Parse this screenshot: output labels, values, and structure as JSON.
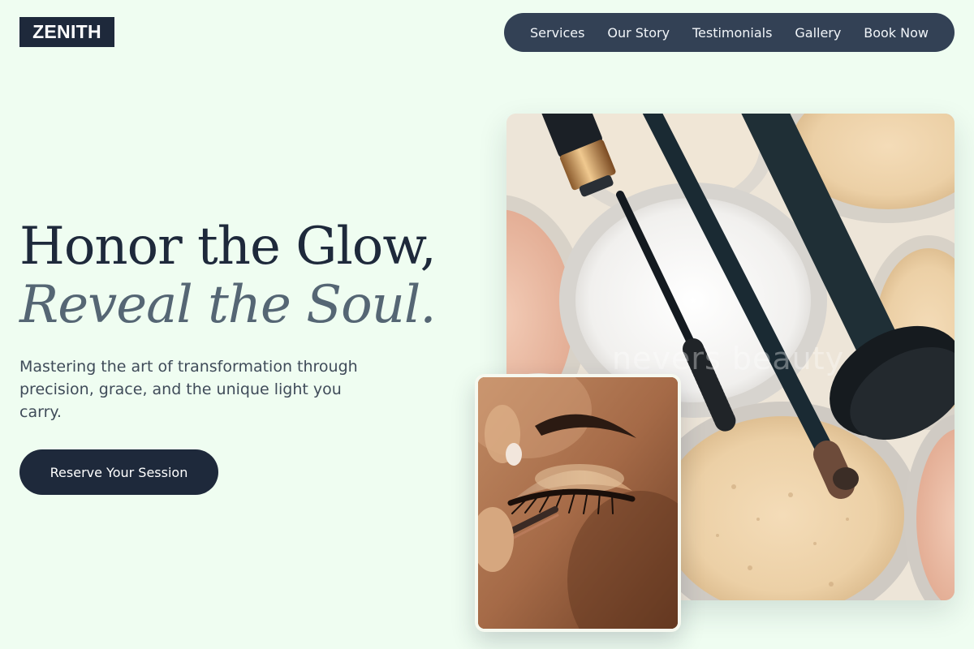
{
  "brand": {
    "logo_text": "ZENITH"
  },
  "nav": {
    "items": [
      {
        "label": "Services"
      },
      {
        "label": "Our Story"
      },
      {
        "label": "Testimonials"
      },
      {
        "label": "Gallery"
      },
      {
        "label": "Book Now"
      }
    ]
  },
  "hero": {
    "headline_line1": "Honor the Glow,",
    "headline_line2": "Reveal the Soul.",
    "subcopy": "Mastering the art of transformation through precision, grace, and the unique light you carry.",
    "cta_label": "Reserve Your Session"
  },
  "images": {
    "main_alt": "Makeup brushes, mascara wand and loose powder jars",
    "main_watermark": "nevers beauty",
    "inset_alt": "Close-up of eyelash application on a closed eye"
  },
  "colors": {
    "page_background": "#effdf1",
    "primary_dark": "#1e293b",
    "nav_background": "#334155",
    "headline_italic": "#556674"
  }
}
